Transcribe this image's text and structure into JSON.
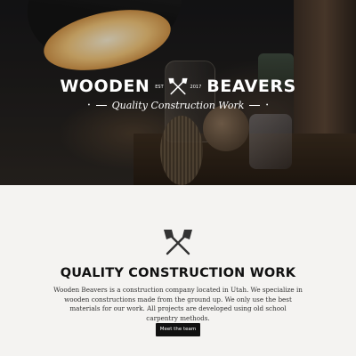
{
  "hero": {
    "logo_left": "WOODEN",
    "logo_right": "BEAVERS",
    "logo_est": "EST",
    "logo_year": "2017",
    "tagline": "Quality Construction Work"
  },
  "section": {
    "icon": "crossed-axes-icon",
    "title": "QUALITY CONSTRUCTION WORK",
    "description": "Wooden Beavers is a construction company located in Utah. We specialize in wooden constructions made from the ground up. We only use the best materials for our work. All projects are developed using old school carpentry methods.",
    "button_label": "Meet the team"
  }
}
